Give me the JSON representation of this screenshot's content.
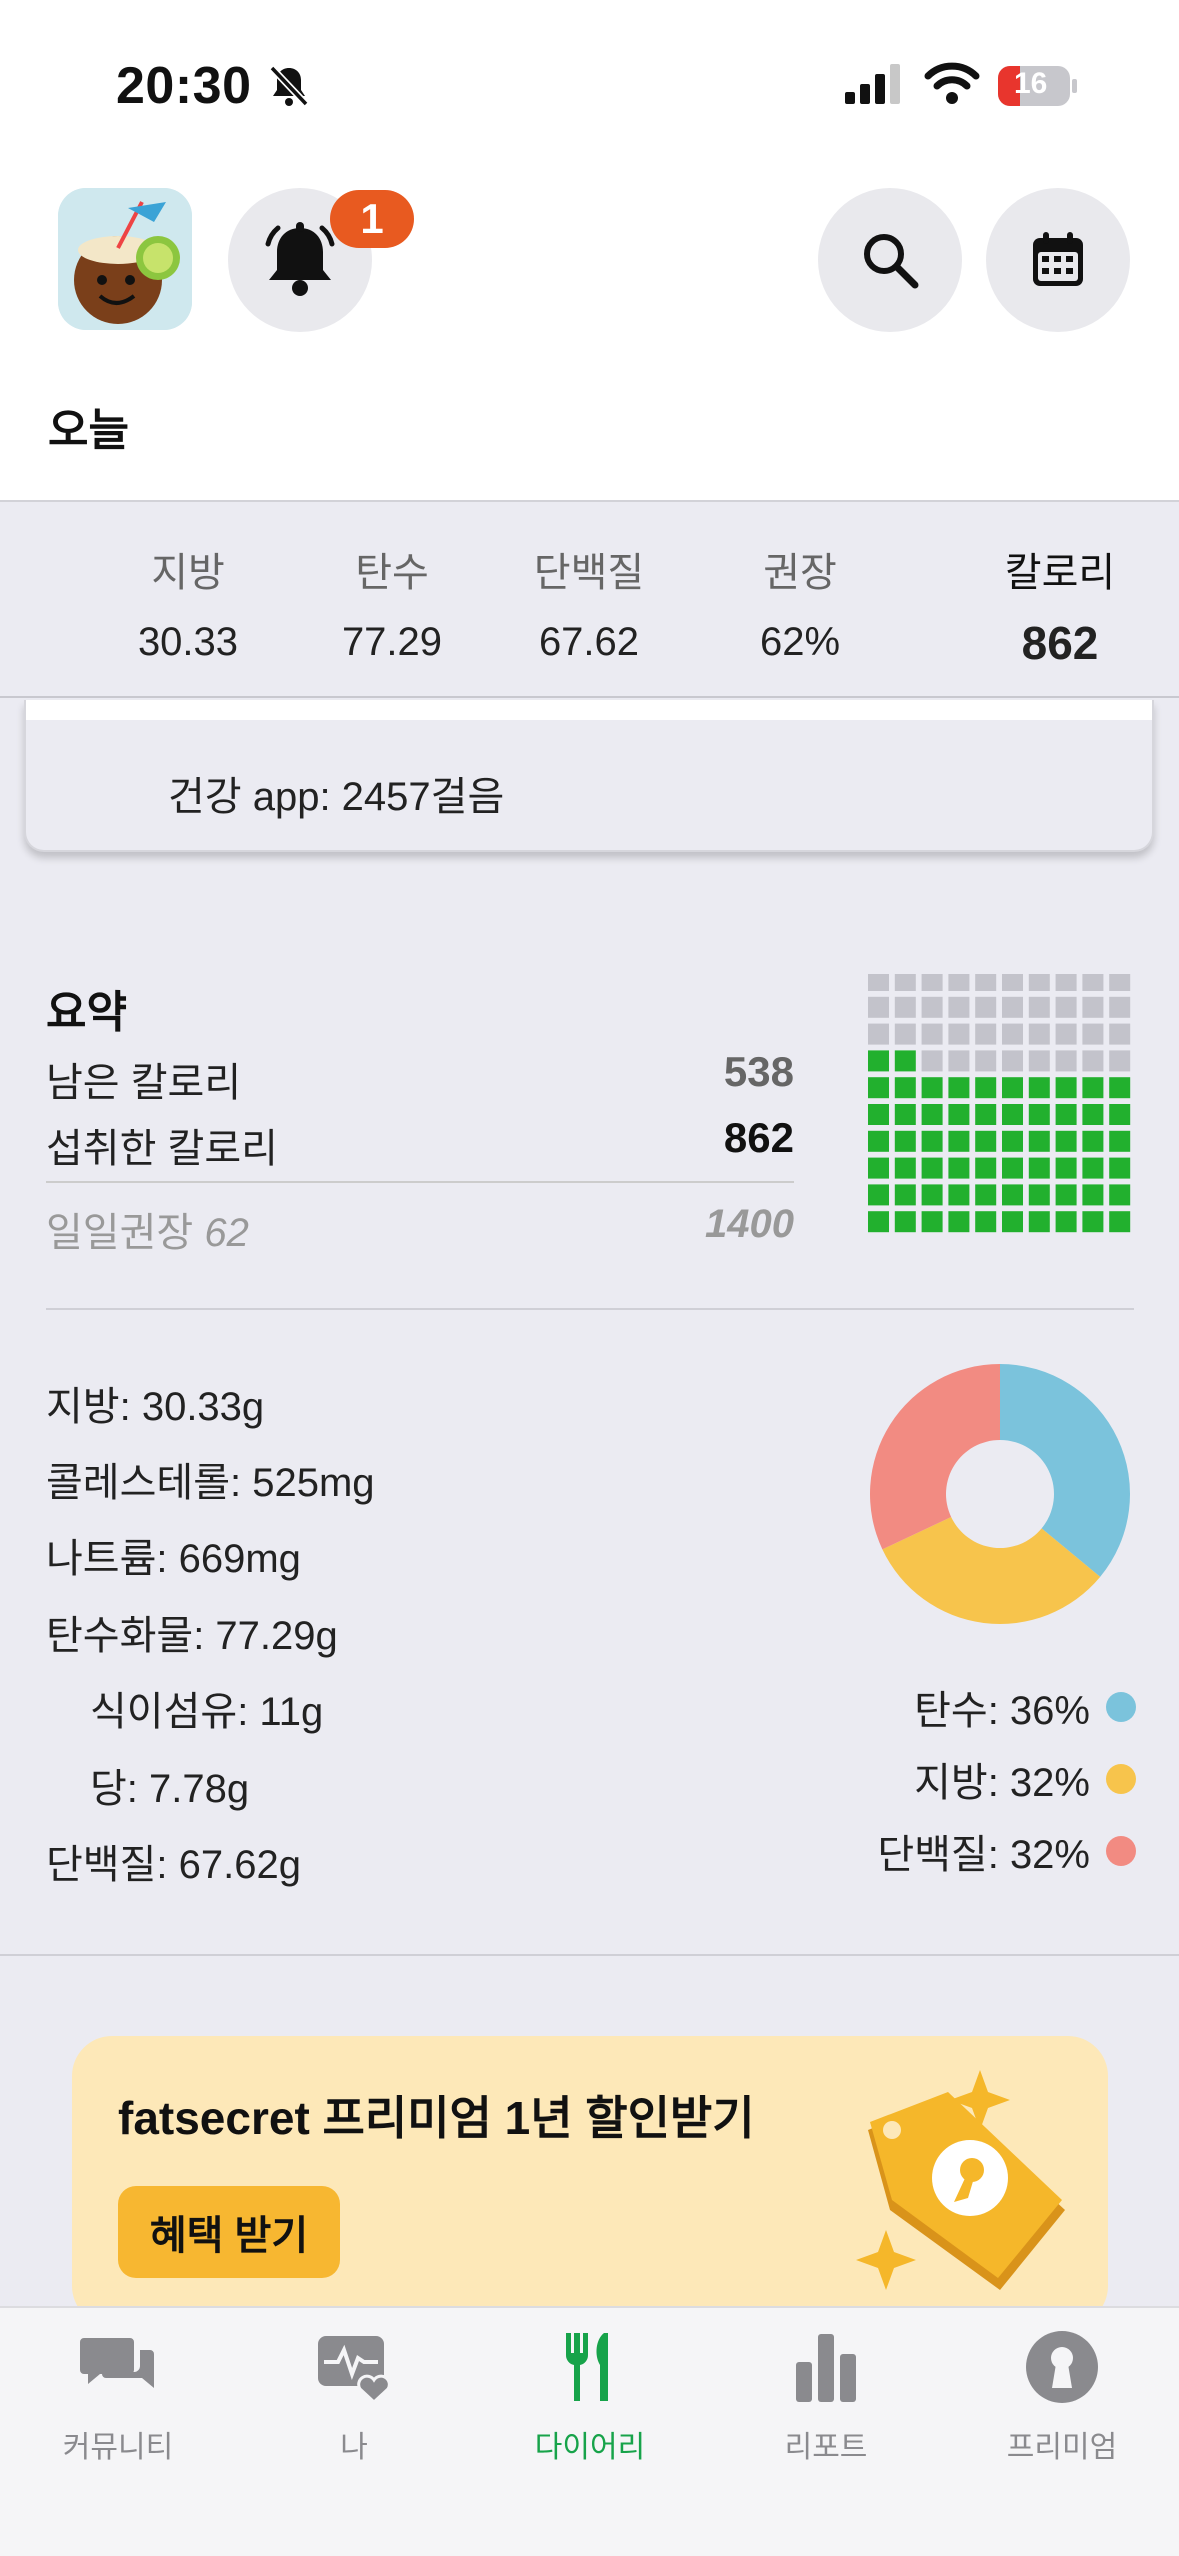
{
  "status_bar": {
    "time": "20:30",
    "battery": "16"
  },
  "header": {
    "notification_count": "1",
    "date_title": "오늘"
  },
  "macros": [
    {
      "label": "지방",
      "value": "30.33"
    },
    {
      "label": "탄수",
      "value": "77.29"
    },
    {
      "label": "단백질",
      "value": "67.62"
    },
    {
      "label": "권장",
      "value": "62%"
    },
    {
      "label": "칼로리",
      "value": "862"
    }
  ],
  "health": {
    "text": "건강 app: 2457걸음"
  },
  "summary": {
    "title": "요약",
    "remaining_label": "남은 칼로리",
    "remaining_value": "538",
    "eaten_label": "섭취한 칼로리",
    "eaten_value": "862",
    "recommended_label": "일일권장",
    "recommended_percent": "62",
    "recommended_value": "1400",
    "grid_filled_fraction": 0.62
  },
  "nutrients": {
    "fat": "지방: 30.33g",
    "cholesterol": "콜레스테롤: 525mg",
    "sodium": "나트륨: 669mg",
    "carbs": "탄수화물: 77.29g",
    "fiber": "식이섬유: 11g",
    "sugar": "당: 7.78g",
    "protein": "단백질: 67.62g"
  },
  "chart_data": {
    "type": "pie",
    "categories": [
      "탄수",
      "지방",
      "단백질"
    ],
    "values": [
      36,
      32,
      32
    ],
    "colors": [
      "#7bc3dc",
      "#f7c44c",
      "#f28b82"
    ],
    "legend": [
      "탄수: 36%",
      "지방: 32%",
      "단백질: 32%"
    ]
  },
  "promo": {
    "title": "fatsecret 프리미엄 1년 할인받기",
    "button": "혜택 받기"
  },
  "tabs": [
    {
      "label": "커뮤니티"
    },
    {
      "label": "나"
    },
    {
      "label": "다이어리"
    },
    {
      "label": "리포트"
    },
    {
      "label": "프리미엄"
    }
  ],
  "colors": {
    "accent_green": "#17a34a",
    "grid_green": "#22b02e",
    "grid_gray": "#c3c3cb",
    "badge": "#e85a20",
    "promo_bg": "#fde8b8",
    "promo_button": "#f7b731"
  }
}
